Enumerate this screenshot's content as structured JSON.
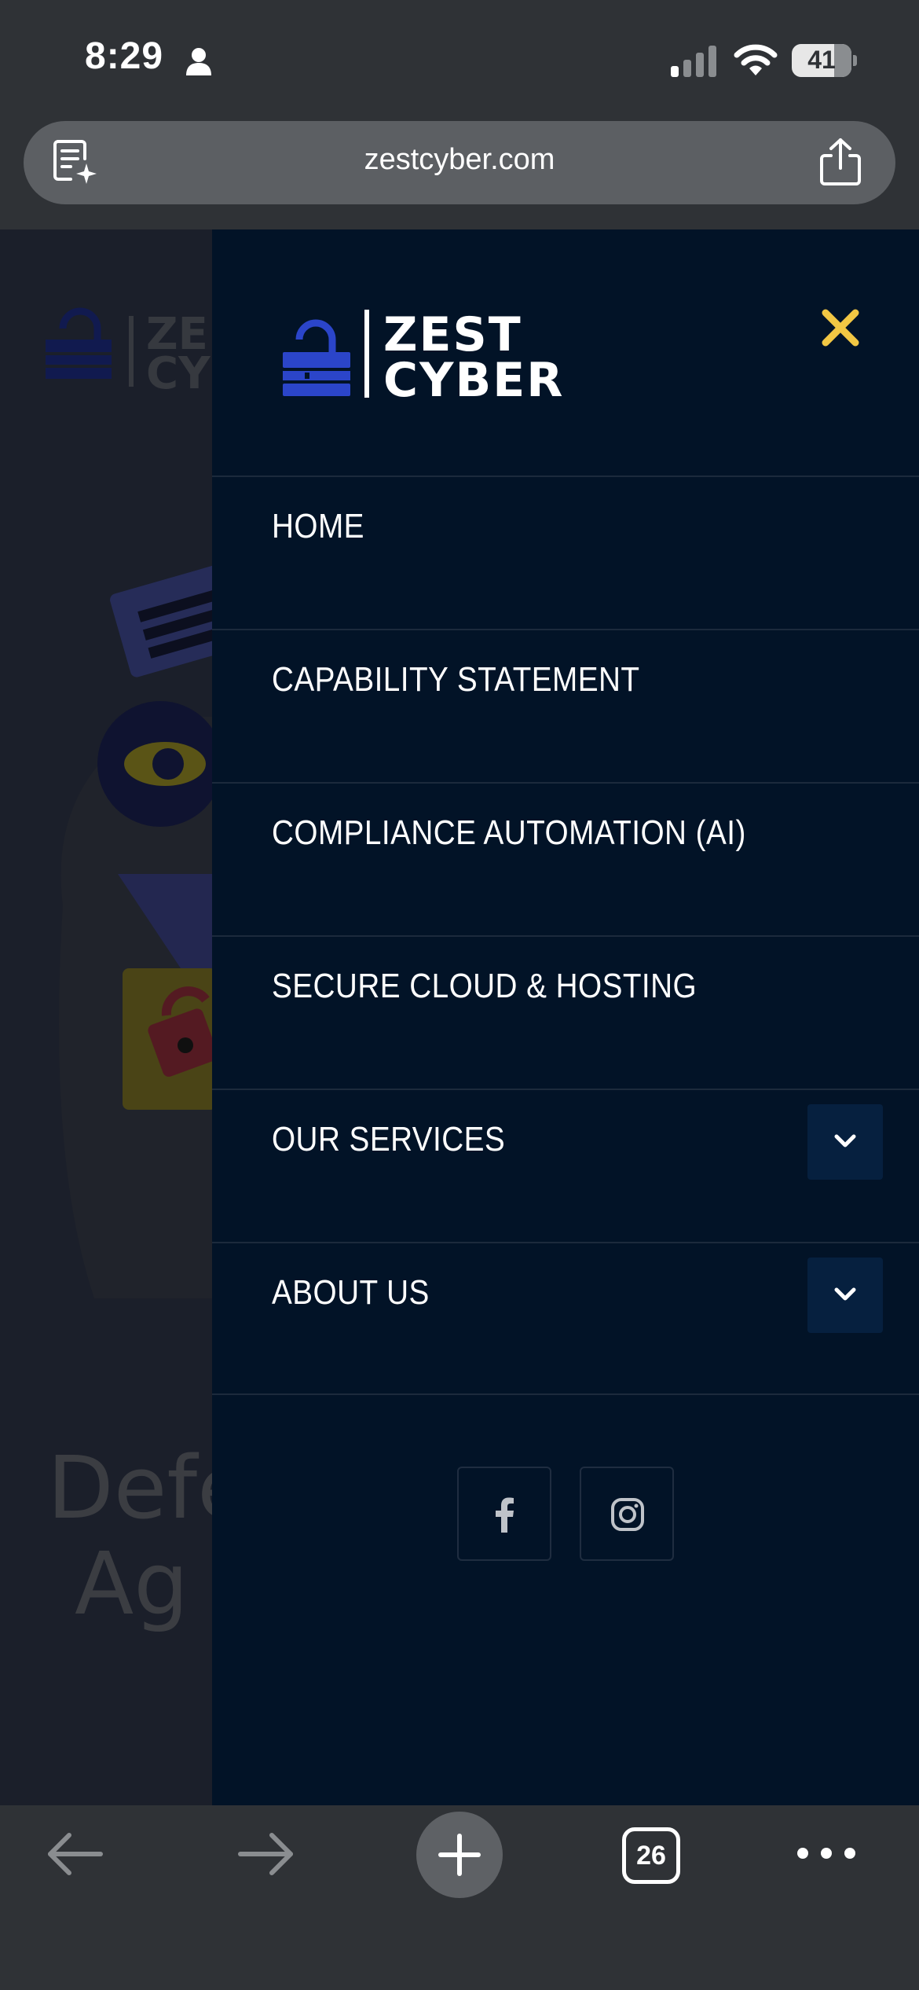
{
  "status_bar": {
    "time": "8:29",
    "battery": "41",
    "icons": [
      "person-icon",
      "signal-icon",
      "wifi-icon",
      "battery-icon"
    ]
  },
  "url_bar": {
    "url": "zestcyber.com",
    "icons": [
      "reader-mode-icon",
      "share-icon"
    ]
  },
  "background_page": {
    "heading_fragment": "Defe\nAg"
  },
  "drawer": {
    "logo": {
      "line1": "ZEST",
      "line2": "CYBER"
    },
    "close_icon": "close-icon",
    "menu": [
      {
        "label": "HOME",
        "expandable": false
      },
      {
        "label": "CAPABILITY STATEMENT",
        "expandable": false
      },
      {
        "label": "COMPLIANCE AUTOMATION (AI)",
        "expandable": false
      },
      {
        "label": "SECURE CLOUD & HOSTING",
        "expandable": false
      },
      {
        "label": "OUR SERVICES",
        "expandable": true
      },
      {
        "label": "ABOUT US",
        "expandable": true
      }
    ],
    "socials": [
      "facebook-icon",
      "instagram-icon"
    ]
  },
  "toolbar": {
    "tab_count": "26",
    "icons": [
      "back-arrow-icon",
      "forward-arrow-icon",
      "plus-icon",
      "tabs-icon",
      "more-icon"
    ]
  },
  "colors": {
    "drawer_bg": "#021327",
    "accent_close": "#f2c744",
    "logo_lock": "#2b45c9",
    "expand_btn_bg": "#06203f",
    "chrome_bg": "#2f3236"
  }
}
